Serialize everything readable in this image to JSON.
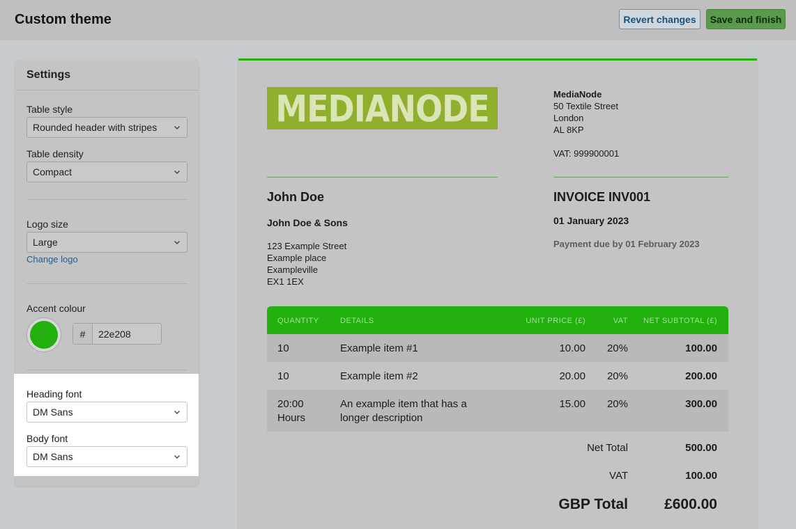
{
  "header": {
    "title": "Custom theme",
    "revert_label": "Revert changes",
    "save_label": "Save and finish"
  },
  "settings": {
    "title": "Settings",
    "table_style": {
      "label": "Table style",
      "value": "Rounded header with stripes"
    },
    "table_density": {
      "label": "Table density",
      "value": "Compact"
    },
    "logo_size": {
      "label": "Logo size",
      "value": "Large",
      "change_link": "Change logo"
    },
    "accent": {
      "label": "Accent colour",
      "prefix": "#",
      "value": "22e208",
      "swatch_color": "#22b00e"
    },
    "heading_font": {
      "label": "Heading font",
      "value": "DM Sans"
    },
    "body_font": {
      "label": "Body font",
      "value": "DM Sans"
    }
  },
  "invoice": {
    "logo_text": "MEDIANODE",
    "company": {
      "name": "MediaNode",
      "street": "50 Textile Street",
      "city": "London",
      "postcode": "AL 8KP",
      "vat": "VAT: 999900001"
    },
    "client": {
      "name": "John Doe",
      "company": "John Doe & Sons",
      "address": [
        "123 Example Street",
        "Example place",
        "Exampleville",
        "EX1 1EX"
      ]
    },
    "number": "INVOICE INV001",
    "date": "01 January 2023",
    "due": "Payment due by 01 February 2023",
    "columns": {
      "quantity": "QUANTITY",
      "details": "DETAILS",
      "unit_price": "UNIT PRICE (£)",
      "vat": "VAT",
      "net": "NET SUBTOTAL (£)"
    },
    "rows": [
      {
        "qty": "10",
        "details": "Example item #1",
        "unit": "10.00",
        "vat": "20%",
        "net": "100.00"
      },
      {
        "qty": "10",
        "details": "Example item #2",
        "unit": "20.00",
        "vat": "20%",
        "net": "200.00"
      },
      {
        "qty_line1": "20:00",
        "qty_line2": "Hours",
        "details_line1": "An example item that has a",
        "details_line2": "longer description",
        "unit": "15.00",
        "vat": "20%",
        "net": "300.00"
      }
    ],
    "totals": {
      "net_label": "Net Total",
      "net_value": "500.00",
      "vat_label": "VAT",
      "vat_value": "100.00",
      "grand_label": "GBP Total",
      "grand_value": "£600.00"
    }
  }
}
